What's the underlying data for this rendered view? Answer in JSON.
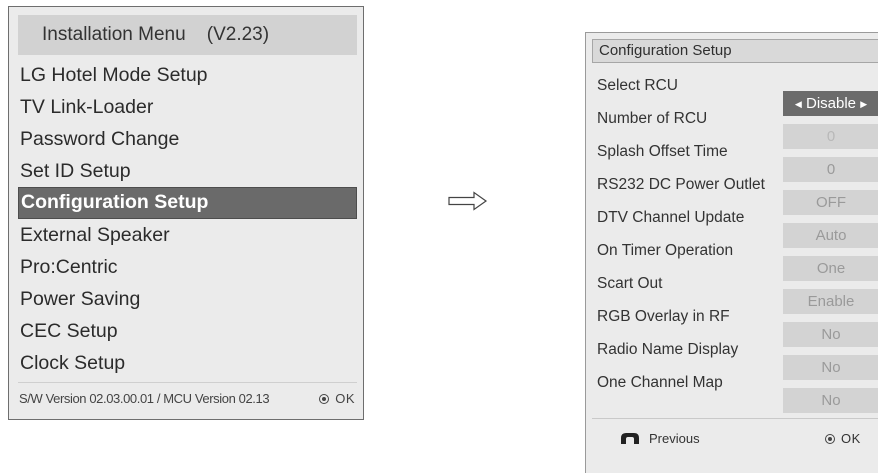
{
  "installation_menu": {
    "title": "Installation Menu    (V2.23)",
    "items": [
      {
        "label": "LG Hotel Mode Setup"
      },
      {
        "label": "TV Link-Loader"
      },
      {
        "label": "Password Change"
      },
      {
        "label": "Set ID Setup"
      },
      {
        "label": "Configuration Setup",
        "selected": true
      },
      {
        "label": "External Speaker"
      },
      {
        "label": "Pro:Centric"
      },
      {
        "label": "Power Saving"
      },
      {
        "label": "CEC Setup"
      },
      {
        "label": "Clock Setup"
      }
    ],
    "footer_version": "S/W Version 02.03.00.01 / MCU Version 02.13",
    "footer_ok": "OK"
  },
  "arrow_icon": "right-arrow-outline-icon",
  "configuration_setup": {
    "title": "Configuration Setup",
    "rows": [
      {
        "label": "Select RCU",
        "value": "Disable",
        "active": true
      },
      {
        "label": "Number of RCU",
        "value": "0",
        "dim": true
      },
      {
        "label": "Splash Offset Time",
        "value": "0"
      },
      {
        "label": "RS232 DC Power Outlet",
        "value": "OFF"
      },
      {
        "label": "DTV Channel Update",
        "value": "Auto"
      },
      {
        "label": "On Timer Operation",
        "value": "One"
      },
      {
        "label": "Scart Out",
        "value": "Enable"
      },
      {
        "label": "RGB Overlay in RF",
        "value": "No"
      },
      {
        "label": "Radio Name Display",
        "value": "No"
      },
      {
        "label": "One Channel Map",
        "value": "No"
      }
    ],
    "footer_previous": "Previous",
    "footer_ok": "OK"
  },
  "colors": {
    "panel_bg": "#ebebeb",
    "selected_bg": "#6a6a6a",
    "value_bg": "#d3d3d3",
    "value_text": "#9a9a9a"
  }
}
